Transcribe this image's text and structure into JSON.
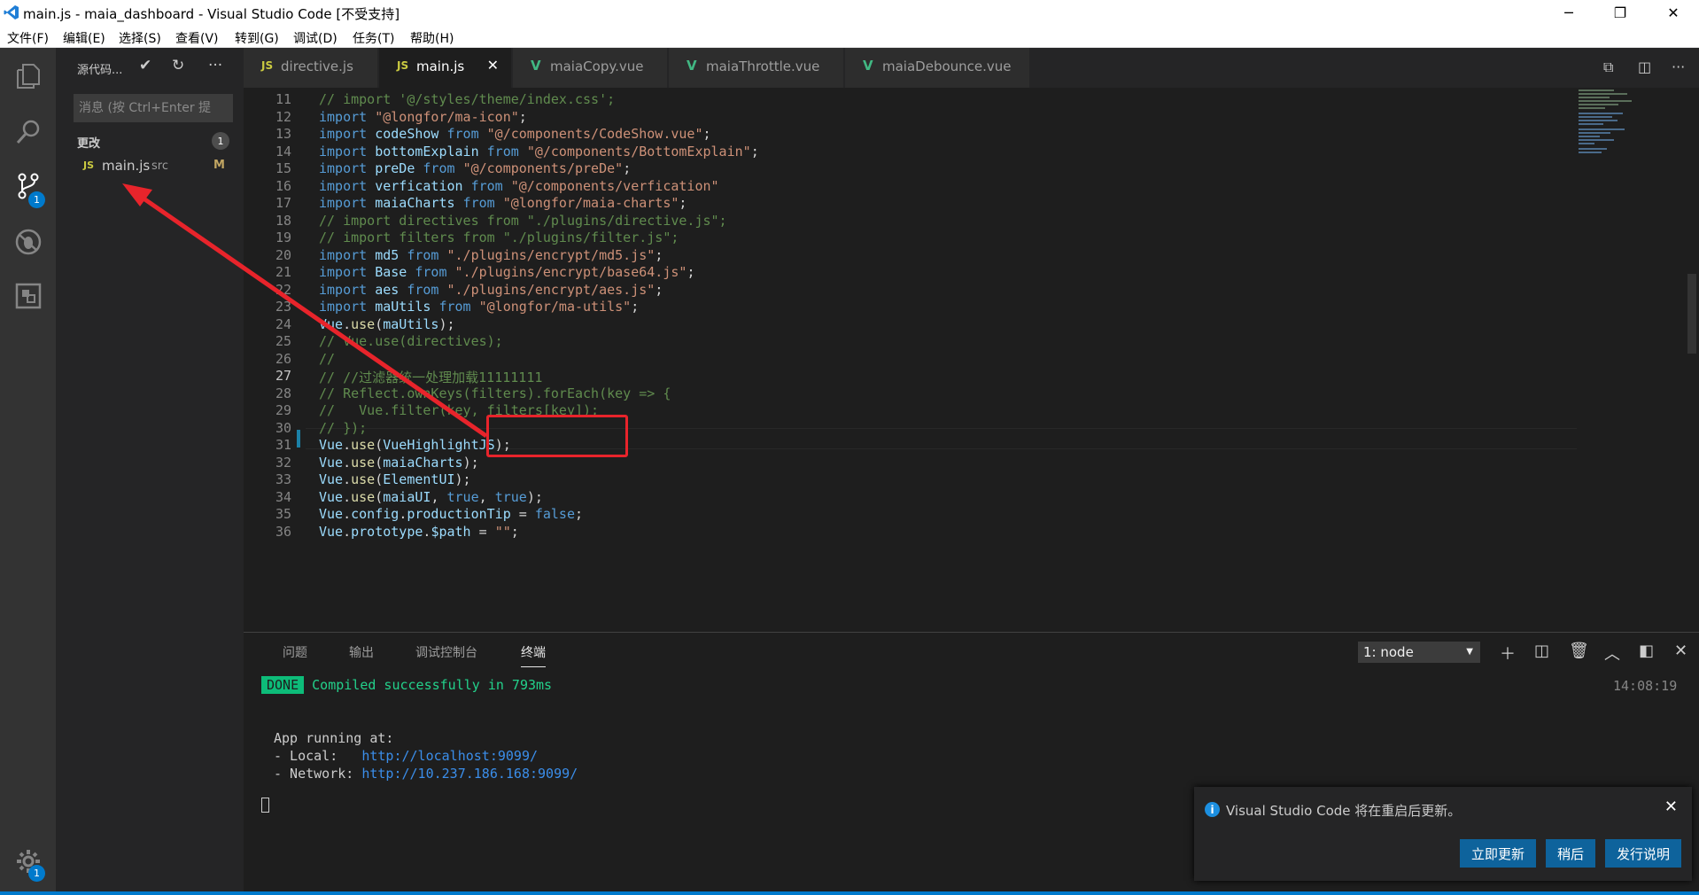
{
  "window": {
    "title": "main.js - maia_dashboard - Visual Studio Code [不受支持]",
    "minimize": "─",
    "restore": "❐",
    "close": "✕"
  },
  "menu": [
    "文件(F)",
    "编辑(E)",
    "选择(S)",
    "查看(V)",
    "转到(G)",
    "调试(D)",
    "任务(T)",
    "帮助(H)"
  ],
  "activity_bar": {
    "items": [
      {
        "name": "explorer-icon"
      },
      {
        "name": "search-icon"
      },
      {
        "name": "source-control-icon",
        "badge": "1"
      },
      {
        "name": "debug-icon"
      },
      {
        "name": "extensions-icon"
      }
    ],
    "settings_badge": "1"
  },
  "sidebar": {
    "title": "源代码...",
    "message_placeholder": "消息 (按 Ctrl+Enter 提",
    "changes_label": "更改",
    "changes_count": "1",
    "files": [
      {
        "type": "JS",
        "name": "main.js",
        "dir": "src",
        "status": "M"
      }
    ]
  },
  "tabs": [
    {
      "type": "JS",
      "label": "directive.js",
      "active": false
    },
    {
      "type": "JS",
      "label": "main.js",
      "active": true,
      "close": "✕"
    },
    {
      "type": "V",
      "label": "maiaCopy.vue",
      "active": false
    },
    {
      "type": "V",
      "label": "maiaThrottle.vue",
      "active": false
    },
    {
      "type": "V",
      "label": "maiaDebounce.vue",
      "active": false
    }
  ],
  "editor": {
    "line_numbers": [
      "11",
      "12",
      "13",
      "14",
      "15",
      "16",
      "17",
      "18",
      "19",
      "20",
      "21",
      "22",
      "23",
      "24",
      "25",
      "26",
      "27",
      "28",
      "29",
      "30",
      "31",
      "32",
      "33",
      "34",
      "35",
      "36"
    ],
    "lines": [
      [
        {
          "c": "cm",
          "t": "// import '@/styles/theme/index.css';"
        }
      ],
      [
        {
          "c": "kw",
          "t": "import "
        },
        {
          "c": "str",
          "t": "\"@longfor/ma-icon\""
        },
        {
          "c": "",
          "t": ";"
        }
      ],
      [
        {
          "c": "kw",
          "t": "import "
        },
        {
          "c": "id",
          "t": "codeShow"
        },
        {
          "c": "kw",
          "t": " from "
        },
        {
          "c": "str",
          "t": "\"@/components/CodeShow.vue\""
        },
        {
          "c": "",
          "t": ";"
        }
      ],
      [
        {
          "c": "kw",
          "t": "import "
        },
        {
          "c": "id",
          "t": "bottomExplain"
        },
        {
          "c": "kw",
          "t": " from "
        },
        {
          "c": "str",
          "t": "\"@/components/BottomExplain\""
        },
        {
          "c": "",
          "t": ";"
        }
      ],
      [
        {
          "c": "kw",
          "t": "import "
        },
        {
          "c": "id",
          "t": "preDe"
        },
        {
          "c": "kw",
          "t": " from "
        },
        {
          "c": "str",
          "t": "\"@/components/preDe\""
        },
        {
          "c": "",
          "t": ";"
        }
      ],
      [
        {
          "c": "kw",
          "t": "import "
        },
        {
          "c": "id",
          "t": "verfication"
        },
        {
          "c": "kw",
          "t": " from "
        },
        {
          "c": "str",
          "t": "\"@/components/verfication\""
        }
      ],
      [
        {
          "c": "kw",
          "t": "import "
        },
        {
          "c": "id",
          "t": "maiaCharts"
        },
        {
          "c": "kw",
          "t": " from "
        },
        {
          "c": "str",
          "t": "\"@longfor/maia-charts\""
        },
        {
          "c": "",
          "t": ";"
        }
      ],
      [
        {
          "c": "cm",
          "t": "// import directives from \"./plugins/directive.js\";"
        }
      ],
      [
        {
          "c": "cm",
          "t": "// import filters from \"./plugins/filter.js\";"
        }
      ],
      [
        {
          "c": "kw",
          "t": "import "
        },
        {
          "c": "id",
          "t": "md5"
        },
        {
          "c": "kw",
          "t": " from "
        },
        {
          "c": "str",
          "t": "\"./plugins/encrypt/md5.js\""
        },
        {
          "c": "",
          "t": ";"
        }
      ],
      [
        {
          "c": "kw",
          "t": "import "
        },
        {
          "c": "id",
          "t": "Base"
        },
        {
          "c": "kw",
          "t": " from "
        },
        {
          "c": "str",
          "t": "\"./plugins/encrypt/base64.js\""
        },
        {
          "c": "",
          "t": ";"
        }
      ],
      [
        {
          "c": "kw",
          "t": "import "
        },
        {
          "c": "id",
          "t": "aes"
        },
        {
          "c": "kw",
          "t": " from "
        },
        {
          "c": "str",
          "t": "\"./plugins/encrypt/aes.js\""
        },
        {
          "c": "",
          "t": ";"
        }
      ],
      [
        {
          "c": "kw",
          "t": "import "
        },
        {
          "c": "id",
          "t": "maUtils"
        },
        {
          "c": "kw",
          "t": " from "
        },
        {
          "c": "str",
          "t": "\"@longfor/ma-utils\""
        },
        {
          "c": "",
          "t": ";"
        }
      ],
      [
        {
          "c": "id",
          "t": "Vue"
        },
        {
          "c": "",
          "t": "."
        },
        {
          "c": "fn",
          "t": "use"
        },
        {
          "c": "",
          "t": "("
        },
        {
          "c": "id",
          "t": "maUtils"
        },
        {
          "c": "",
          "t": ");"
        }
      ],
      [
        {
          "c": "cm",
          "t": "// Vue.use(directives);"
        }
      ],
      [
        {
          "c": "cm",
          "t": "//"
        }
      ],
      [
        {
          "c": "cm",
          "t": "// //过滤器统一处理加载11111111"
        }
      ],
      [
        {
          "c": "cm",
          "t": "// Reflect.ownKeys(filters).forEach(key => {"
        }
      ],
      [
        {
          "c": "cm",
          "t": "//   Vue.filter(key, filters[key]);"
        }
      ],
      [
        {
          "c": "cm",
          "t": "// });"
        }
      ],
      [
        {
          "c": "id",
          "t": "Vue"
        },
        {
          "c": "",
          "t": "."
        },
        {
          "c": "fn",
          "t": "use"
        },
        {
          "c": "",
          "t": "("
        },
        {
          "c": "id",
          "t": "VueHighlightJS"
        },
        {
          "c": "",
          "t": ");"
        }
      ],
      [
        {
          "c": "id",
          "t": "Vue"
        },
        {
          "c": "",
          "t": "."
        },
        {
          "c": "fn",
          "t": "use"
        },
        {
          "c": "",
          "t": "("
        },
        {
          "c": "id",
          "t": "maiaCharts"
        },
        {
          "c": "",
          "t": ");"
        }
      ],
      [
        {
          "c": "id",
          "t": "Vue"
        },
        {
          "c": "",
          "t": "."
        },
        {
          "c": "fn",
          "t": "use"
        },
        {
          "c": "",
          "t": "("
        },
        {
          "c": "id",
          "t": "ElementUI"
        },
        {
          "c": "",
          "t": ");"
        }
      ],
      [
        {
          "c": "id",
          "t": "Vue"
        },
        {
          "c": "",
          "t": "."
        },
        {
          "c": "fn",
          "t": "use"
        },
        {
          "c": "",
          "t": "("
        },
        {
          "c": "id",
          "t": "maiaUI"
        },
        {
          "c": "",
          "t": ", "
        },
        {
          "c": "bool",
          "t": "true"
        },
        {
          "c": "",
          "t": ", "
        },
        {
          "c": "bool",
          "t": "true"
        },
        {
          "c": "",
          "t": ");"
        }
      ],
      [
        {
          "c": "id",
          "t": "Vue"
        },
        {
          "c": "",
          "t": "."
        },
        {
          "c": "id",
          "t": "config"
        },
        {
          "c": "",
          "t": "."
        },
        {
          "c": "id",
          "t": "productionTip"
        },
        {
          "c": "",
          "t": " = "
        },
        {
          "c": "bool",
          "t": "false"
        },
        {
          "c": "",
          "t": ";"
        }
      ],
      [
        {
          "c": "id",
          "t": "Vue"
        },
        {
          "c": "",
          "t": "."
        },
        {
          "c": "id",
          "t": "prototype"
        },
        {
          "c": "",
          "t": "."
        },
        {
          "c": "id",
          "t": "$path"
        },
        {
          "c": "",
          "t": " = "
        },
        {
          "c": "str",
          "t": "\"\""
        },
        {
          "c": "",
          "t": ";"
        }
      ]
    ]
  },
  "panel": {
    "tabs": [
      "问题",
      "输出",
      "调试控制台",
      "终端"
    ],
    "active_tab": "终端",
    "terminal_select": "1: node",
    "timestamp": "14:08:19",
    "done_label": "DONE",
    "compiled": "Compiled successfully in 793ms",
    "app_running": "App running at:",
    "local_label": "- Local:   ",
    "local_url": "http://localhost:9099/",
    "network_label": "- Network: ",
    "network_url": "http://10.237.186.168:9099/"
  },
  "notification": {
    "message": "Visual Studio Code 将在重启后更新。",
    "close": "✕",
    "buttons": [
      "立即更新",
      "稍后",
      "发行说明"
    ]
  },
  "colors": {
    "accent": "#007acc",
    "annotation_red": "#e8242b"
  }
}
